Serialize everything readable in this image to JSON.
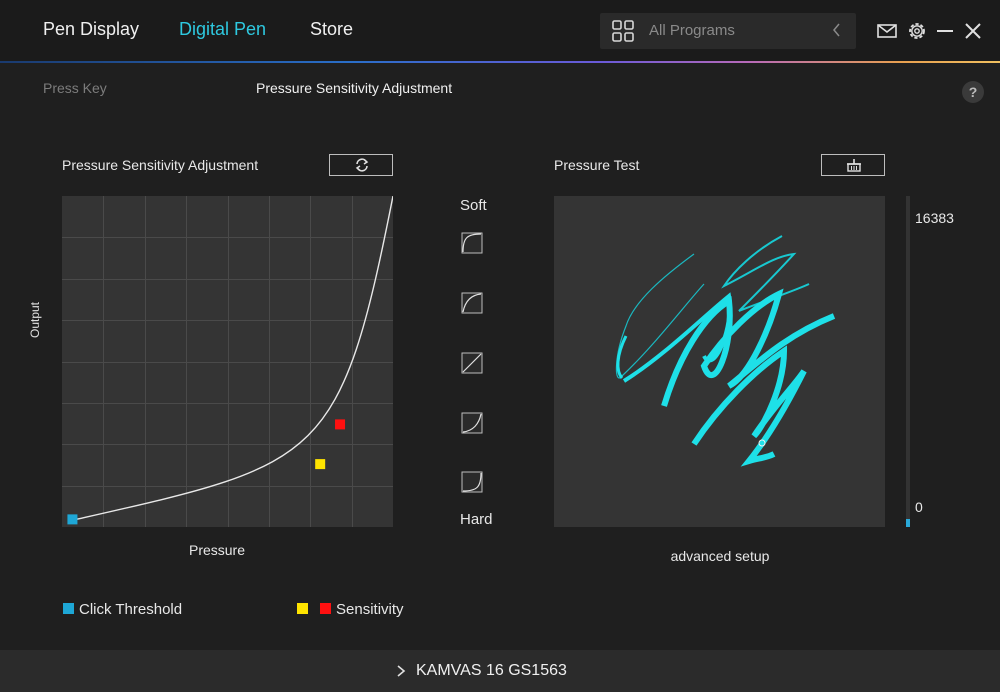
{
  "nav": {
    "tabs": [
      {
        "label": "Pen Display"
      },
      {
        "label": "Digital Pen"
      },
      {
        "label": "Store"
      }
    ],
    "active_tab": "Digital Pen"
  },
  "programs": {
    "selected": "All Programs"
  },
  "subtabs": {
    "press_key": "Press Key",
    "pressure": "Pressure Sensitivity Adjustment"
  },
  "help": "?",
  "curve_panel": {
    "title": "Pressure Sensitivity Adjustment",
    "ylabel": "Output",
    "xlabel": "Pressure",
    "threshold": 0.03,
    "sensitivity_yellow": [
      0.78,
      0.19
    ],
    "sensitivity_red": [
      0.84,
      0.31
    ]
  },
  "presets": {
    "soft_label": "Soft",
    "hard_label": "Hard"
  },
  "test_panel": {
    "title": "Pressure Test",
    "max_value": "16383",
    "min_value": "0",
    "current_level": 0.0,
    "advanced_label": "advanced setup"
  },
  "legend": {
    "click_threshold": "Click Threshold",
    "sensitivity": "Sensitivity"
  },
  "device": {
    "name": "KAMVAS 16 GS1563"
  },
  "colors": {
    "accent": "#2ec9e0",
    "threshold": "#1ea7d6",
    "sensitivity_yellow": "#ffe400",
    "sensitivity_red": "#ff1010",
    "stroke": "#18e0e8"
  }
}
